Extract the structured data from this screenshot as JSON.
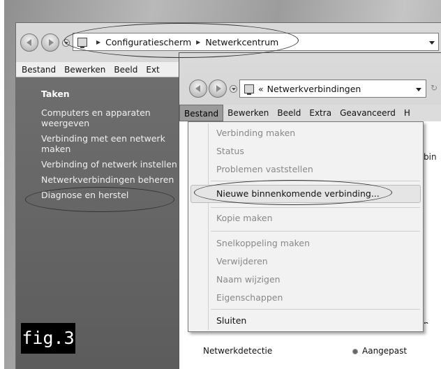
{
  "figure_label": "fig.3",
  "back_window": {
    "breadcrumb": [
      "Configuratiescherm",
      "Netwerkcentrum"
    ],
    "menu": [
      "Bestand",
      "Bewerken",
      "Beeld",
      "Ext"
    ],
    "tasks_title": "Taken",
    "tasks": [
      "Computers en apparaten weergeven",
      "Verbinding met een netwerk maken",
      "Verbinding of netwerk instellen",
      "Netwerkverbindingen beheren",
      "Diagnose en herstel"
    ]
  },
  "front_window": {
    "breadcrumb_prefix": "«",
    "breadcrumb": "Netwerkverbindingen",
    "menu": [
      "Bestand",
      "Bewerken",
      "Beeld",
      "Extra",
      "Geavanceerd",
      "H"
    ],
    "active_menu": "Bestand",
    "partial_right_text": "bin",
    "partial_bottom_text": "n ge",
    "lower_rows": [
      {
        "label": "Netwerkdetectie",
        "value": "Aangepast"
      }
    ]
  },
  "bestand_menu": {
    "items": [
      {
        "label": "Verbinding maken",
        "enabled": false
      },
      {
        "label": "Status",
        "enabled": false
      },
      {
        "label": "Problemen vaststellen",
        "enabled": false
      },
      {
        "label": "Nieuwe binnenkomende verbinding...",
        "enabled": true,
        "highlighted": true
      },
      {
        "label": "Kopie maken",
        "enabled": false
      },
      {
        "label": "Snelkoppeling maken",
        "enabled": false
      },
      {
        "label": "Verwijderen",
        "enabled": false
      },
      {
        "label": "Naam wijzigen",
        "enabled": false
      },
      {
        "label": "Eigenschappen",
        "enabled": false
      },
      {
        "label": "Sluiten",
        "enabled": true
      }
    ]
  }
}
